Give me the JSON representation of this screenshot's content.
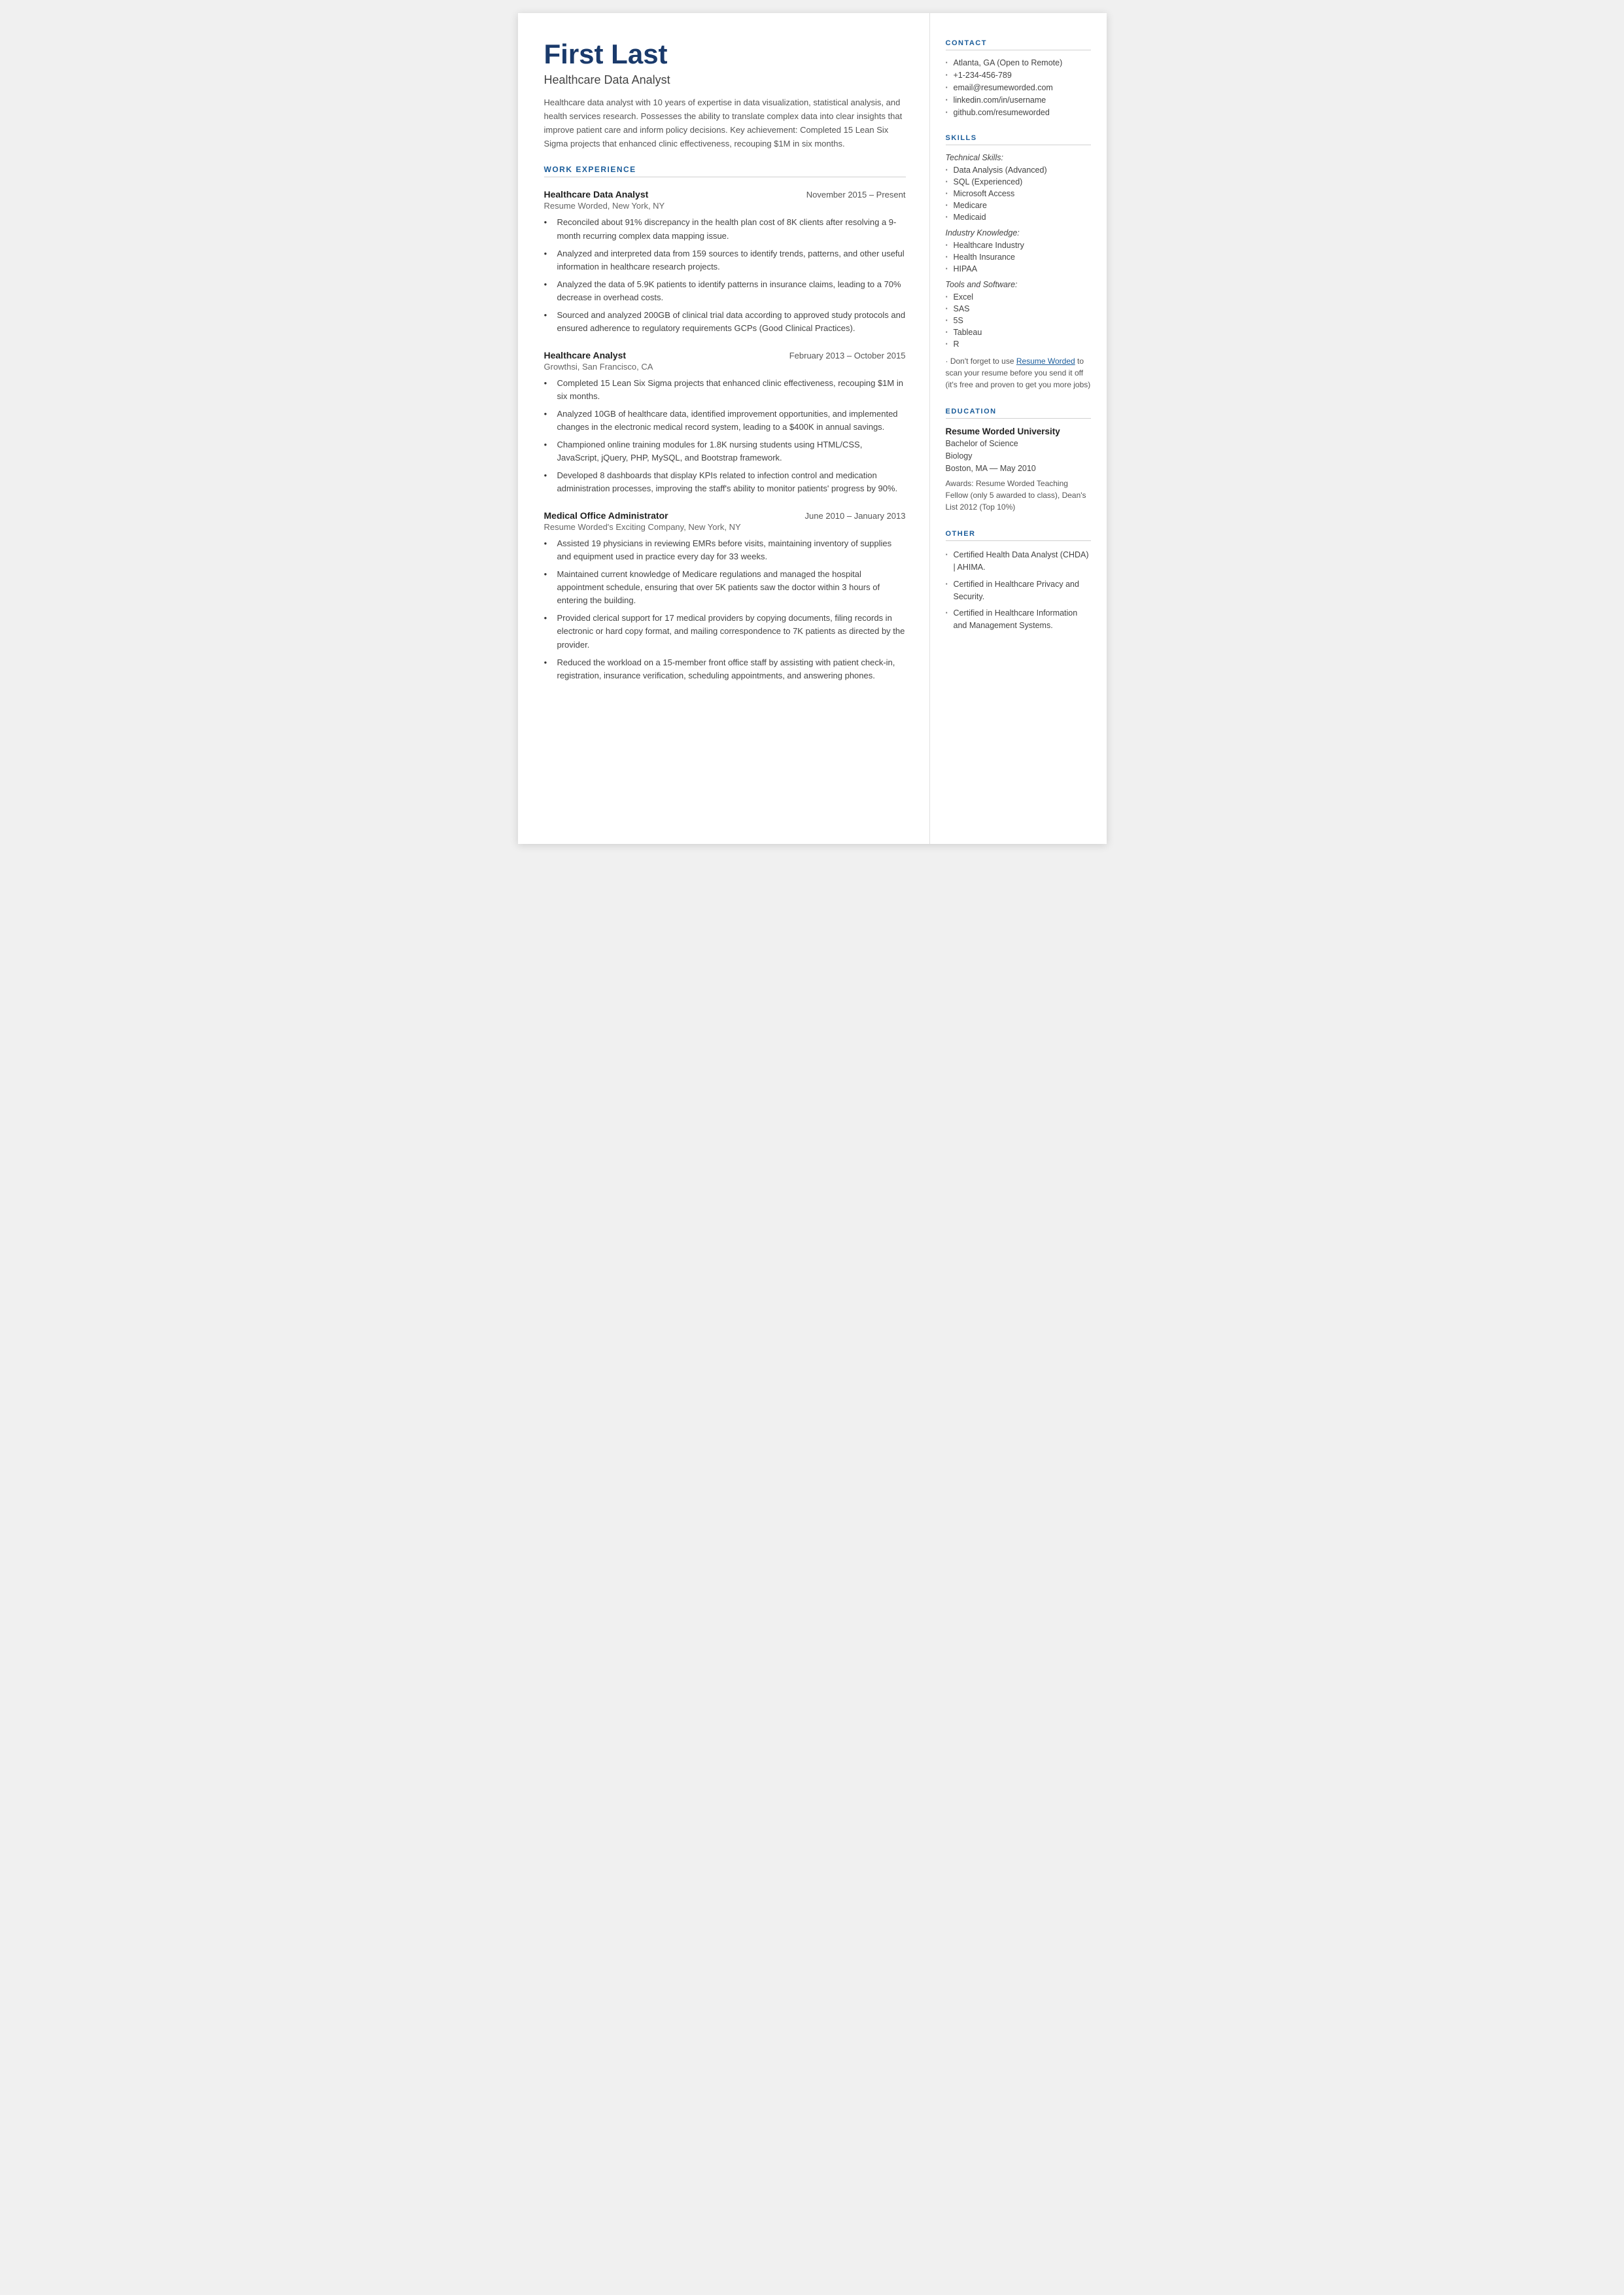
{
  "header": {
    "name": "First Last",
    "title": "Healthcare Data Analyst",
    "summary": "Healthcare data analyst with 10 years of expertise in data visualization, statistical analysis, and health services research. Possesses the ability to translate complex data into clear insights that improve patient care and inform policy decisions. Key achievement: Completed 15 Lean Six Sigma projects that enhanced clinic effectiveness, recouping $1M in six months."
  },
  "sections": {
    "work_experience_label": "WORK EXPERIENCE",
    "jobs": [
      {
        "title": "Healthcare Data Analyst",
        "dates": "November 2015 – Present",
        "company": "Resume Worded, New York, NY",
        "bullets": [
          "Reconciled about 91% discrepancy in the health plan cost of 8K clients after resolving a 9-month recurring complex data mapping issue.",
          "Analyzed and interpreted data from 159 sources to identify trends, patterns, and other useful information in healthcare research projects.",
          "Analyzed the data of 5.9K patients to identify patterns in insurance claims, leading to a 70% decrease in overhead costs.",
          "Sourced and analyzed 200GB of clinical trial data according to approved study protocols and ensured adherence to regulatory requirements GCPs (Good Clinical Practices)."
        ]
      },
      {
        "title": "Healthcare Analyst",
        "dates": "February 2013 – October 2015",
        "company": "Growthsi, San Francisco, CA",
        "bullets": [
          "Completed 15 Lean Six Sigma projects that enhanced clinic effectiveness, recouping $1M in six months.",
          "Analyzed 10GB of healthcare data, identified improvement opportunities, and implemented changes in the electronic medical record system, leading to a $400K in annual savings.",
          "Championed online training modules for 1.8K nursing students using HTML/CSS, JavaScript, jQuery, PHP, MySQL, and Bootstrap framework.",
          "Developed 8 dashboards that display KPIs related to infection control and medication administration processes, improving the staff's ability to monitor patients' progress by 90%."
        ]
      },
      {
        "title": "Medical Office Administrator",
        "dates": "June 2010 – January 2013",
        "company": "Resume Worded's Exciting Company, New York, NY",
        "bullets": [
          "Assisted 19 physicians in reviewing EMRs before visits, maintaining inventory of supplies and equipment used in practice every day for 33 weeks.",
          "Maintained current knowledge of Medicare regulations and managed the hospital appointment schedule, ensuring that over 5K patients saw the doctor within 3 hours of entering the building.",
          "Provided clerical support for 17 medical providers by copying documents, filing records in electronic or hard copy format, and mailing correspondence to 7K patients as directed by the provider.",
          "Reduced the workload on a 15-member front office staff by assisting with patient check-in, registration, insurance verification, scheduling appointments, and answering phones."
        ]
      }
    ]
  },
  "sidebar": {
    "contact_label": "CONTACT",
    "contact_items": [
      "Atlanta, GA (Open to Remote)",
      "+1-234-456-789",
      "email@resumeworded.com",
      "linkedin.com/in/username",
      "github.com/resumeworded"
    ],
    "skills_label": "SKILLS",
    "skill_groups": [
      {
        "category": "Technical Skills:",
        "items": [
          "Data Analysis (Advanced)",
          "SQL (Experienced)",
          "Microsoft Access",
          "Medicare",
          "Medicaid"
        ]
      },
      {
        "category": "Industry Knowledge:",
        "items": [
          "Healthcare Industry",
          "Health Insurance",
          "HIPAA"
        ]
      },
      {
        "category": "Tools and Software:",
        "items": [
          "Excel",
          "SAS",
          "5S",
          "Tableau",
          "R"
        ]
      }
    ],
    "promo_prefix": "· Don't forget to use ",
    "promo_link_text": "Resume Worded",
    "promo_suffix": " to scan your resume before you send it off (it's free and proven to get you more jobs)",
    "education_label": "EDUCATION",
    "education": {
      "school": "Resume Worded University",
      "degree": "Bachelor of Science",
      "field": "Biology",
      "location_date": "Boston, MA — May 2010",
      "awards": "Awards: Resume Worded Teaching Fellow (only 5 awarded to class), Dean's List 2012 (Top 10%)"
    },
    "other_label": "OTHER",
    "other_items": [
      "Certified Health Data Analyst (CHDA) | AHIMA.",
      "Certified in Healthcare Privacy and Security.",
      "Certified in Healthcare Information and Management Systems."
    ]
  }
}
